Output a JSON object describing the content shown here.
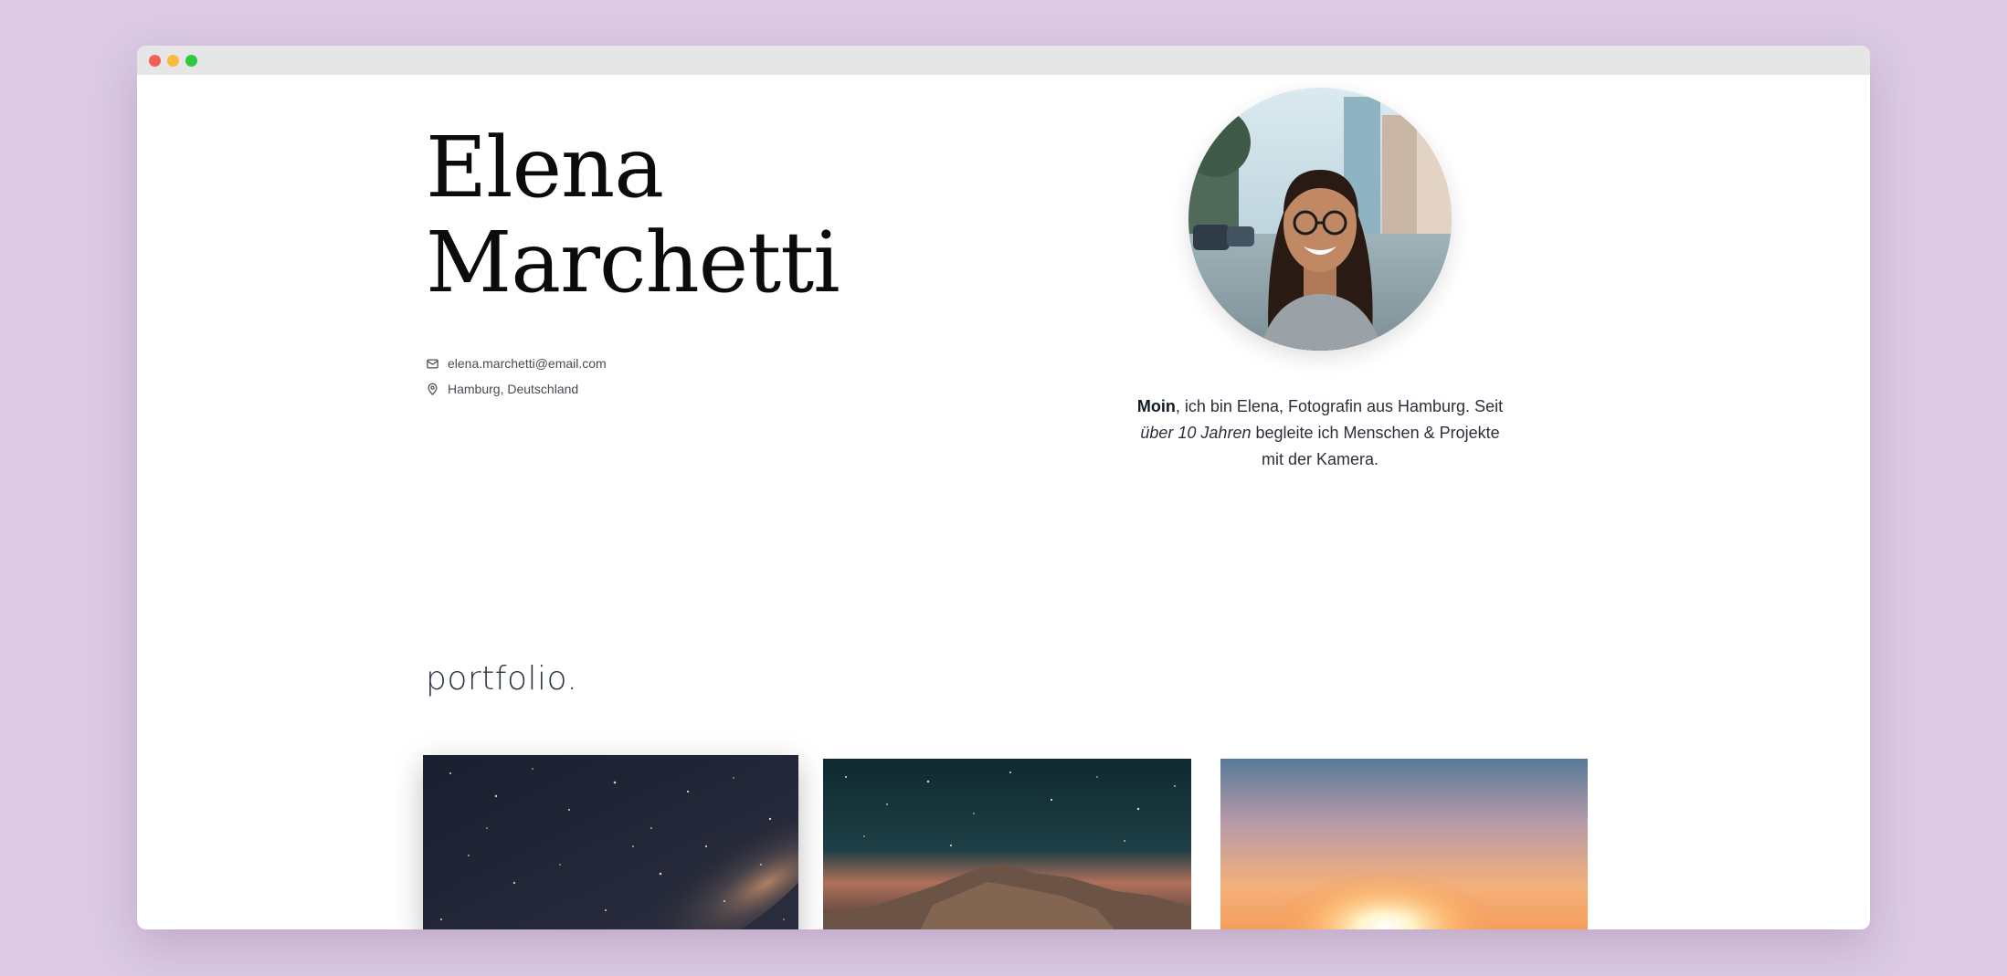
{
  "window": {
    "controls": [
      "close",
      "minimize",
      "maximize"
    ]
  },
  "profile": {
    "first_name": "Elena",
    "last_name": "Marchetti",
    "email": "elena.marchetti@email.com",
    "location": "Hamburg, Deutschland",
    "avatar": "portrait-photo"
  },
  "bio": {
    "greeting": "Moin",
    "part1": ", ich bin Elena, Fotografin aus Hamburg. Seit ",
    "emphasis": "über 10 Jahren",
    "part2": " begleite ich Menschen & Projekte mit der Kamera."
  },
  "portfolio": {
    "title": "portfolio.",
    "items": [
      {
        "subject": "milky-way-night-sky"
      },
      {
        "subject": "starry-sky-over-mountains"
      },
      {
        "subject": "sunset-over-horizon"
      }
    ]
  },
  "colors": {
    "background": "#dccae3",
    "titlebar": "#e6e6e6",
    "close": "#f25f57",
    "minimize": "#f8bb3a",
    "maximize": "#2fc840",
    "text_dark": "#0b0b0b",
    "text_muted": "#4a4a55"
  }
}
